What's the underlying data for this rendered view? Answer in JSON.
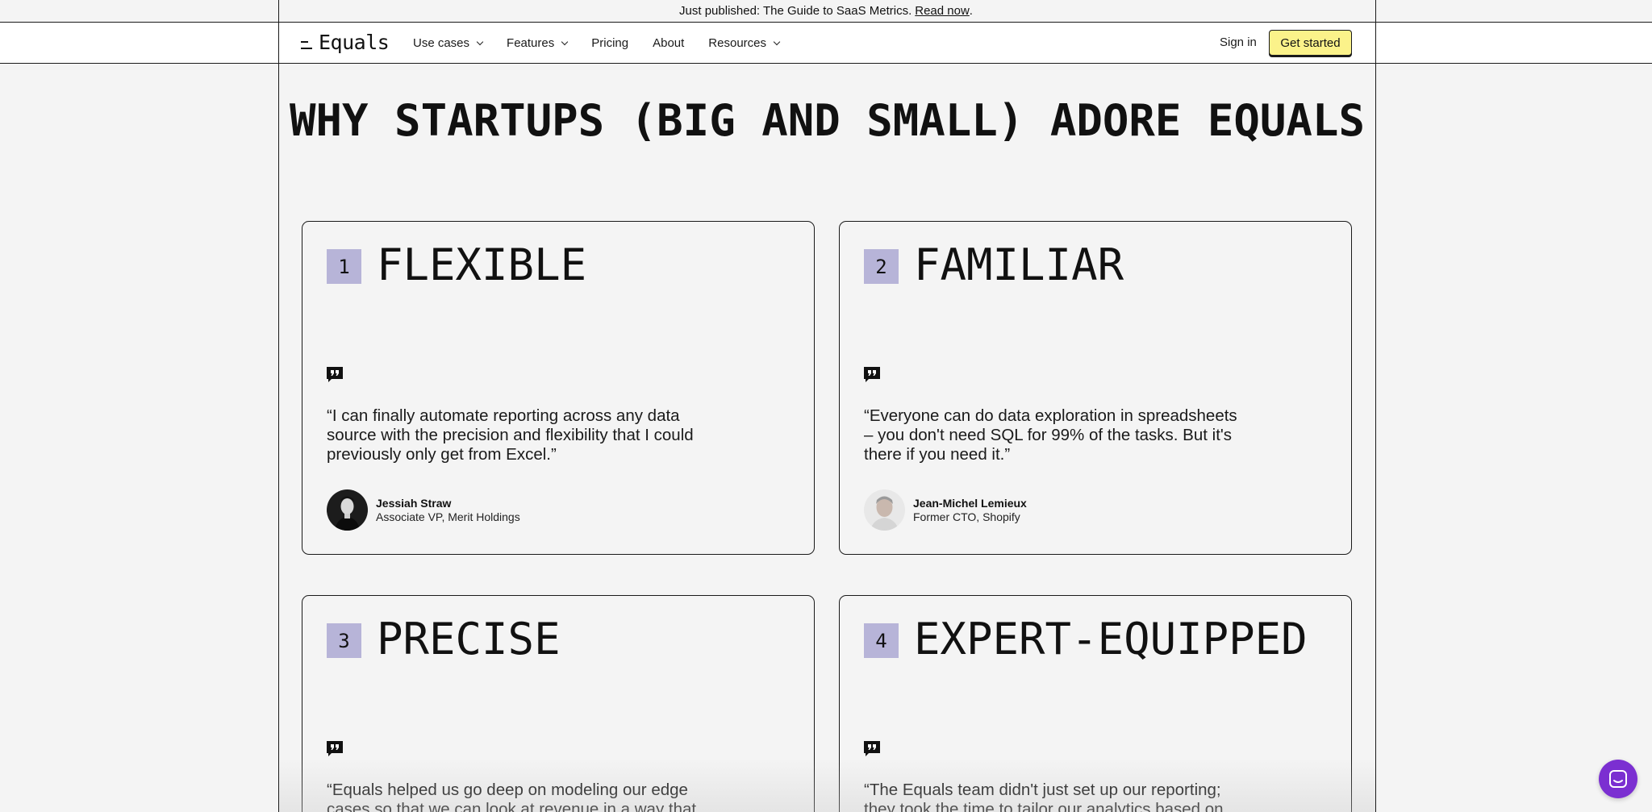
{
  "announcement": {
    "text": "Just published: The Guide to SaaS Metrics.",
    "link": "Read now",
    "suffix": "."
  },
  "nav": {
    "logo": "Equals",
    "items": [
      {
        "label": "Use cases",
        "dropdown": true
      },
      {
        "label": "Features",
        "dropdown": true
      },
      {
        "label": "Pricing",
        "dropdown": false
      },
      {
        "label": "About",
        "dropdown": false
      },
      {
        "label": "Resources",
        "dropdown": true
      }
    ],
    "signin": "Sign in",
    "cta": "Get started"
  },
  "headline": "WHY STARTUPS (BIG AND SMALL) ADORE EQUALS",
  "cards": [
    {
      "number": "1",
      "title": "FLEXIBLE",
      "quote": "“I can finally automate reporting across any data source with the precision and flexibility that I could previously only get from Excel.”",
      "author": "Jessiah Straw",
      "role": "Associate VP, Merit Holdings"
    },
    {
      "number": "2",
      "title": "FAMILIAR",
      "quote": "“Everyone can do data exploration in spreadsheets – you don't need SQL for 99% of the tasks. But it's there if you need it.”",
      "author": "Jean-Michel Lemieux",
      "role": "Former CTO, Shopify"
    },
    {
      "number": "3",
      "title": "PRECISE",
      "quote": "“Equals helped us go deep on modeling our edge cases so that we can look at revenue in a way that",
      "author": "",
      "role": ""
    },
    {
      "number": "4",
      "title": "EXPERT-EQUIPPED",
      "quote": "“The Equals team didn't just set up our reporting; they took the time to tailor our analytics based on",
      "author": "",
      "role": ""
    }
  ],
  "colors": {
    "accent": "#fbf28a",
    "badge": "#b7b4d8",
    "chat": "#7b2fd1"
  },
  "icons": [
    "quote-icon",
    "chevron-down-icon",
    "chat-icon"
  ]
}
